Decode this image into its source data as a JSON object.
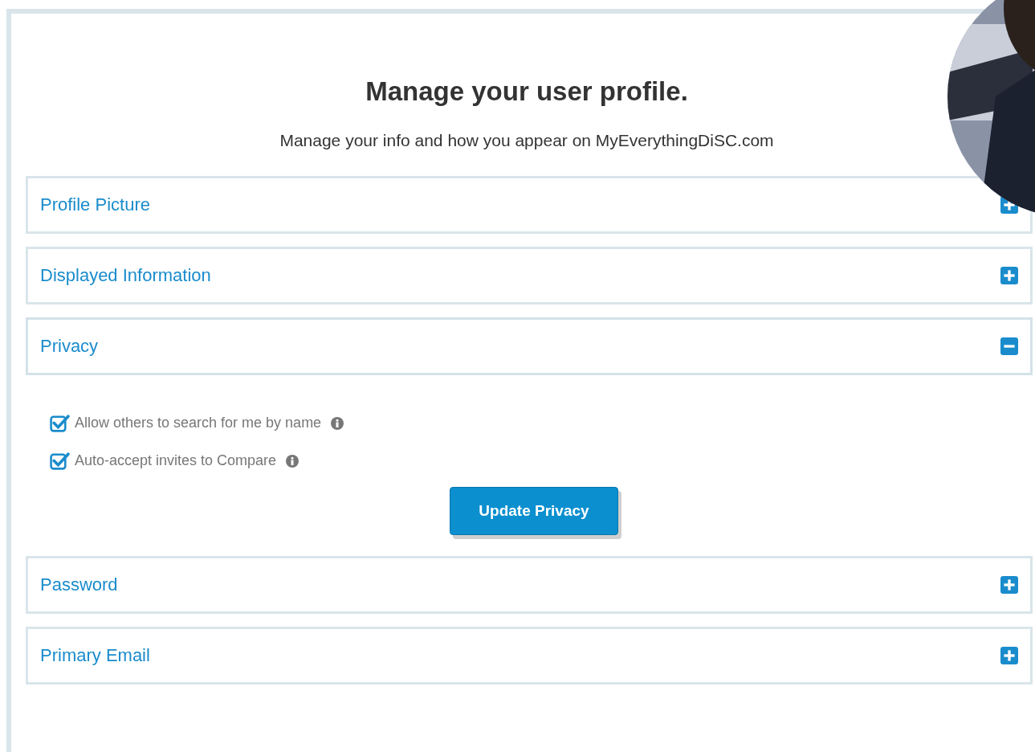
{
  "header": {
    "title": "Manage your user profile.",
    "subtitle": "Manage your info and how you appear on MyEverythingDiSC.com"
  },
  "sections": [
    {
      "title": "Profile Picture",
      "expanded": false
    },
    {
      "title": "Displayed Information",
      "expanded": false
    },
    {
      "title": "Privacy",
      "expanded": true,
      "options": [
        {
          "label": "Allow others to search for me by name",
          "checked": true
        },
        {
          "label": "Auto-accept invites to Compare",
          "checked": true
        }
      ],
      "button": "Update Privacy"
    },
    {
      "title": "Password",
      "expanded": false
    },
    {
      "title": "Primary Email",
      "expanded": false
    }
  ]
}
